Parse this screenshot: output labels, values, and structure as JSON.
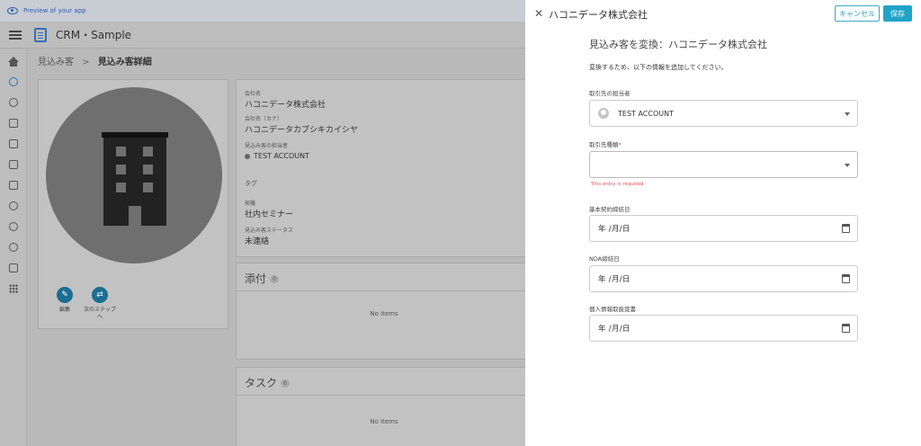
{
  "preview_bar": {
    "text": "Preview of your app"
  },
  "header": {
    "app_title": "CRM・Sample"
  },
  "breadcrumb": {
    "parent": "見込み客",
    "separator": ">",
    "current": "見込み客詳細"
  },
  "profile_actions": [
    {
      "label": "編集",
      "icon": "edit-icon"
    },
    {
      "label": "次のステップへ",
      "icon": "swap-icon"
    }
  ],
  "info": {
    "company_label": "会社名",
    "company_value": "ハコニデータ株式会社",
    "kana_label": "会社名（カナ）",
    "kana_value": "ハコニデータカブシキカイシヤ",
    "owner_label": "見込み客の担当者",
    "owner_value": "TEST ACCOUNT",
    "tag_label": "タグ",
    "source_label": "契機",
    "source_value": "社内セミナー",
    "status_label": "見込み客ステータス",
    "status_value": "未連絡"
  },
  "attachments": {
    "title": "添付",
    "count": "0",
    "empty": "No items"
  },
  "tasks": {
    "title": "タスク",
    "count": "0",
    "empty": "No items"
  },
  "drawer": {
    "title": "ハコニデータ株式会社",
    "cancel_label": "キャンセル",
    "save_label": "保存",
    "heading": "見込み客を変換：ハコニデータ株式会社",
    "description": "変換するため、以下の情報を追加してください。",
    "fields": {
      "owner": {
        "label": "取引先の担当者",
        "value": "TEST ACCOUNT"
      },
      "account_type": {
        "label": "取引先種類",
        "required_mark": "*",
        "value": "",
        "error": "This entry is required"
      },
      "contract_date": {
        "label": "基本契約締結日",
        "value": "年 /月/日"
      },
      "nda_date": {
        "label": "NDA締結日",
        "value": "年 /月/日"
      },
      "privacy_doc": {
        "label": "個人情報取扱覚書",
        "value": "年 /月/日"
      }
    }
  },
  "colors": {
    "accent": "#1fa3c7",
    "error": "#e05252",
    "action": "#1b6e91"
  }
}
